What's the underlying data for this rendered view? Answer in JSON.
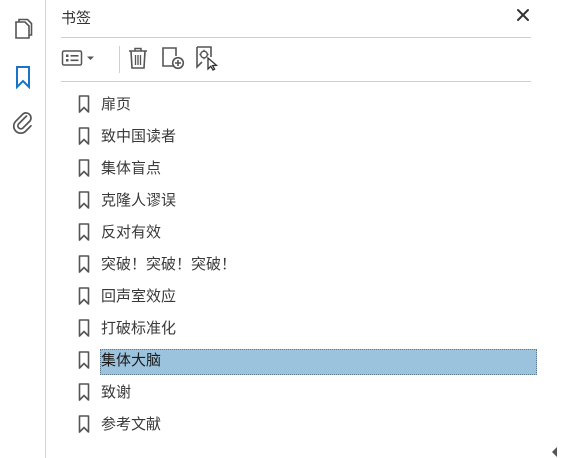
{
  "rail": {
    "items": [
      {
        "name": "pages",
        "icon": "pages-icon"
      },
      {
        "name": "bookmarks",
        "icon": "bookmark-icon",
        "active": true
      },
      {
        "name": "attachments",
        "icon": "paperclip-icon"
      }
    ]
  },
  "panel": {
    "title": "书签",
    "close_icon": "close-icon"
  },
  "toolbar": {
    "buttons": [
      {
        "name": "options-menu",
        "icon": "list-options-icon"
      },
      {
        "name": "delete-bookmark",
        "icon": "trash-icon"
      },
      {
        "name": "new-bookmark",
        "icon": "new-bookmark-icon"
      },
      {
        "name": "find-current-bookmark",
        "icon": "find-bookmark-icon"
      }
    ]
  },
  "bookmarks": [
    {
      "label": "扉页"
    },
    {
      "label": "致中国读者"
    },
    {
      "label": "集体盲点"
    },
    {
      "label": "克隆人谬误"
    },
    {
      "label": "反对有效"
    },
    {
      "label": "突破！突破！突破！"
    },
    {
      "label": "回声室效应"
    },
    {
      "label": "打破标准化"
    },
    {
      "label": "集体大脑",
      "selected": true
    },
    {
      "label": "致谢"
    },
    {
      "label": "参考文献"
    }
  ],
  "colors": {
    "accent": "#1a73c8",
    "selection": "#9cc3de",
    "icon": "#555555"
  }
}
